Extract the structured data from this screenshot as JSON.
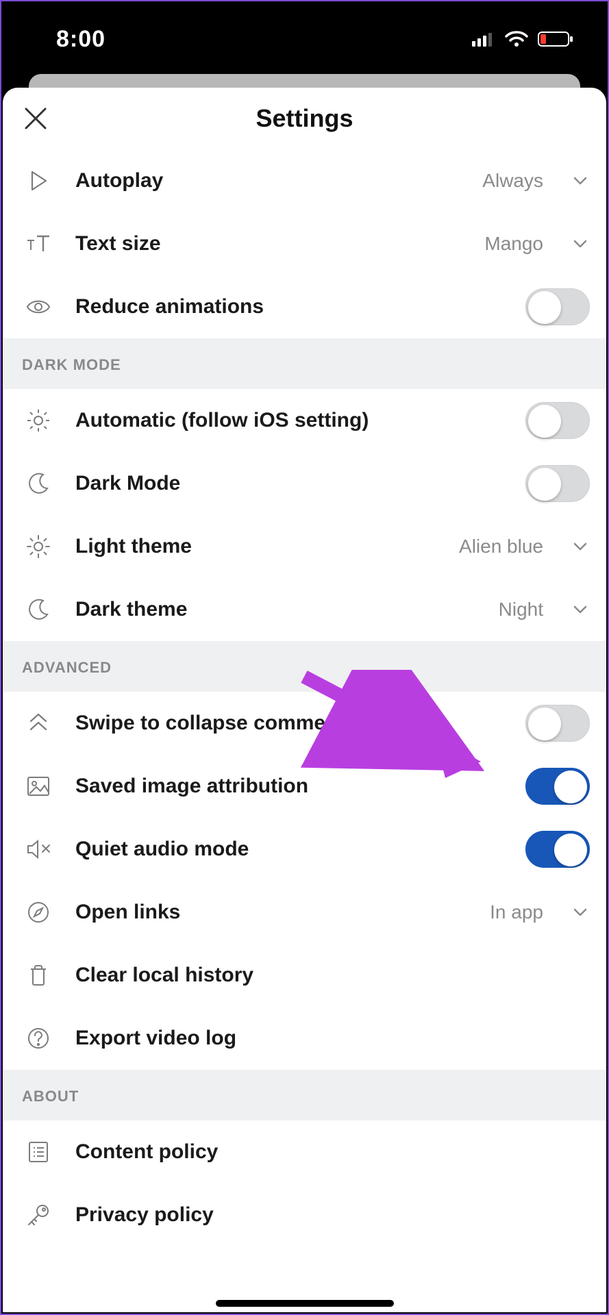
{
  "statusbar": {
    "time": "8:00"
  },
  "header": {
    "title": "Settings"
  },
  "rows": {
    "autoplay": {
      "label": "Autoplay",
      "value": "Always"
    },
    "textsize": {
      "label": "Text size",
      "value": "Mango"
    },
    "reduce_anim": {
      "label": "Reduce animations"
    }
  },
  "sections": {
    "darkmode": {
      "title": "DARK MODE"
    },
    "advanced": {
      "title": "ADVANCED"
    },
    "about": {
      "title": "ABOUT"
    }
  },
  "darkmode": {
    "automatic": {
      "label": "Automatic (follow iOS setting)"
    },
    "darkmode": {
      "label": "Dark Mode"
    },
    "light_theme": {
      "label": "Light theme",
      "value": "Alien blue"
    },
    "dark_theme": {
      "label": "Dark theme",
      "value": "Night"
    }
  },
  "advanced": {
    "swipe_collapse": {
      "label": "Swipe to collapse comments"
    },
    "saved_img_attr": {
      "label": "Saved image attribution"
    },
    "quiet_audio": {
      "label": "Quiet audio mode"
    },
    "open_links": {
      "label": "Open links",
      "value": "In app"
    },
    "clear_history": {
      "label": "Clear local history"
    },
    "export_log": {
      "label": "Export video log"
    }
  },
  "about": {
    "content_policy": {
      "label": "Content policy"
    },
    "privacy_policy": {
      "label": "Privacy policy"
    }
  },
  "toggles": {
    "reduce_anim": false,
    "automatic": false,
    "darkmode": false,
    "swipe_collapse": false,
    "saved_img_attr": true,
    "quiet_audio": true
  },
  "colors": {
    "accent_blue": "#1857b8",
    "arrow_magenta": "#b93ee0"
  }
}
